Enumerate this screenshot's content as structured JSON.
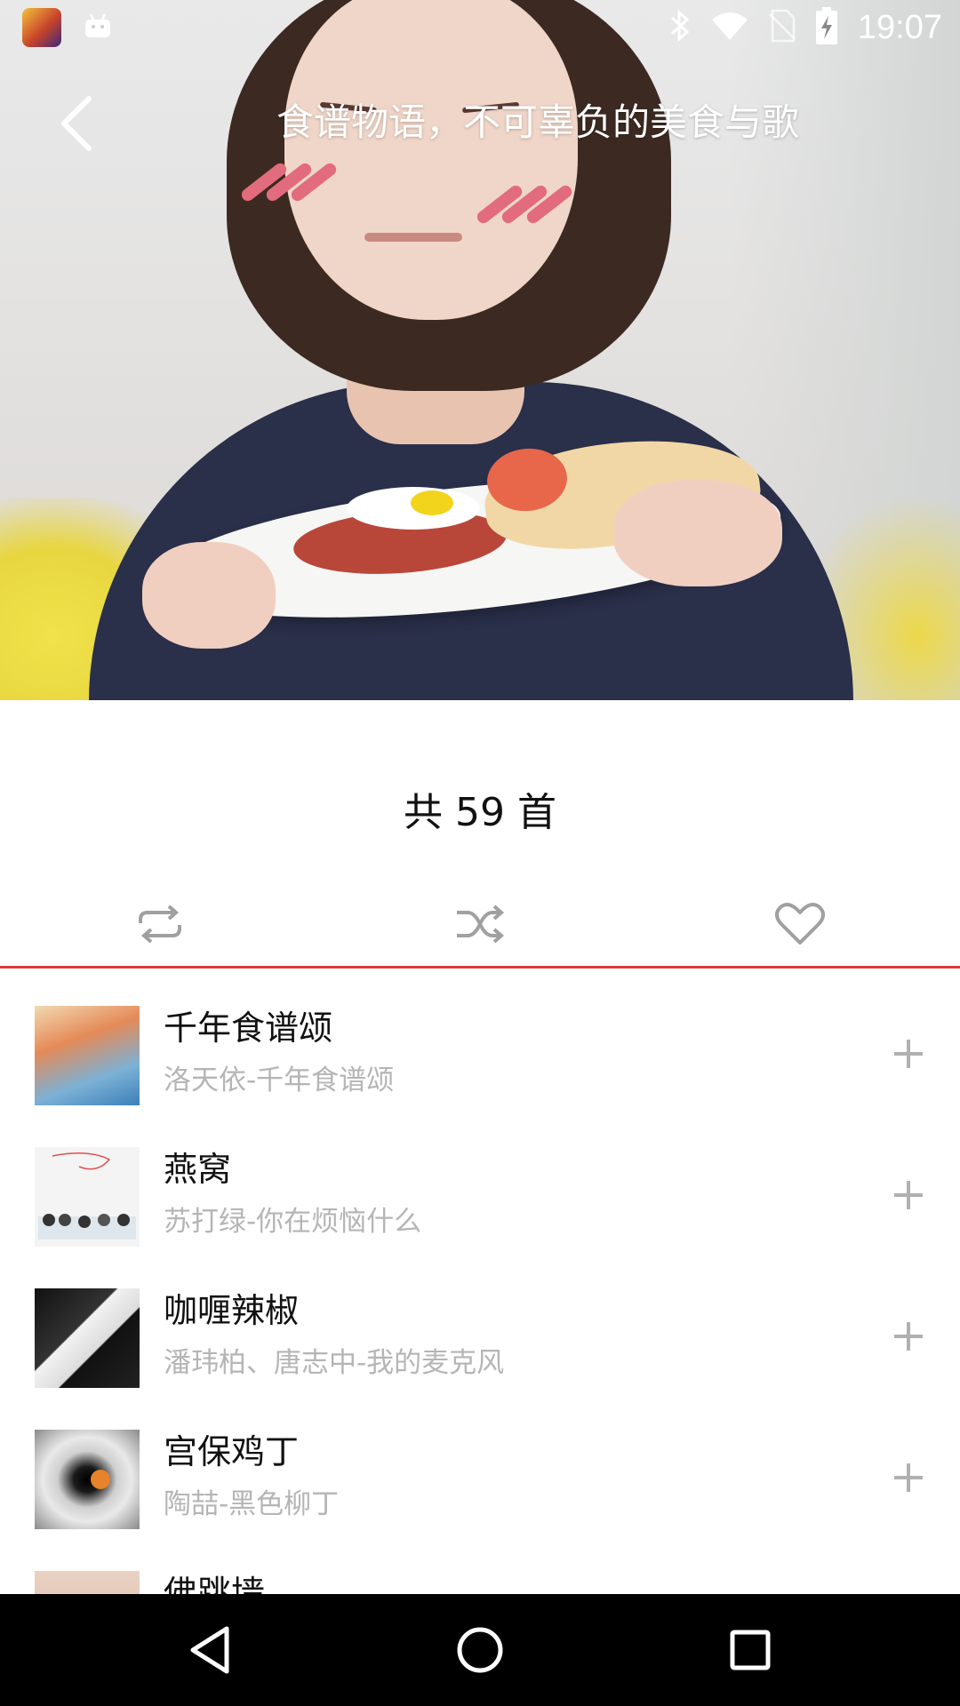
{
  "status_bar": {
    "time": "19:07",
    "icons": [
      "game-app-icon",
      "android-icon",
      "bluetooth-icon",
      "wifi-icon",
      "no-sim-icon",
      "battery-charging-icon"
    ]
  },
  "header": {
    "back_icon": "chevron-left-icon",
    "title": "食谱物语，不可辜负的美食与歌"
  },
  "playlist": {
    "count_label": "共 59 首"
  },
  "actions": [
    {
      "icon": "repeat-icon"
    },
    {
      "icon": "shuffle-icon"
    },
    {
      "icon": "heart-icon"
    }
  ],
  "colors": {
    "accent": "#d83c3c",
    "subtitle": "#b5b5b5",
    "nav_bg": "#000000"
  },
  "songs": [
    {
      "title": "千年食谱颂",
      "subtitle": "洛天依-千年食谱颂"
    },
    {
      "title": "燕窝",
      "subtitle": "苏打绿-你在烦恼什么"
    },
    {
      "title": "咖喱辣椒",
      "subtitle": "潘玮柏、唐志中-我的麦克风"
    },
    {
      "title": "宫保鸡丁",
      "subtitle": "陶喆-黑色柳丁"
    },
    {
      "title": "佛跳墙",
      "subtitle": ""
    }
  ],
  "nav_bar": {
    "icons": [
      "nav-back-icon",
      "nav-home-icon",
      "nav-recents-icon"
    ]
  }
}
